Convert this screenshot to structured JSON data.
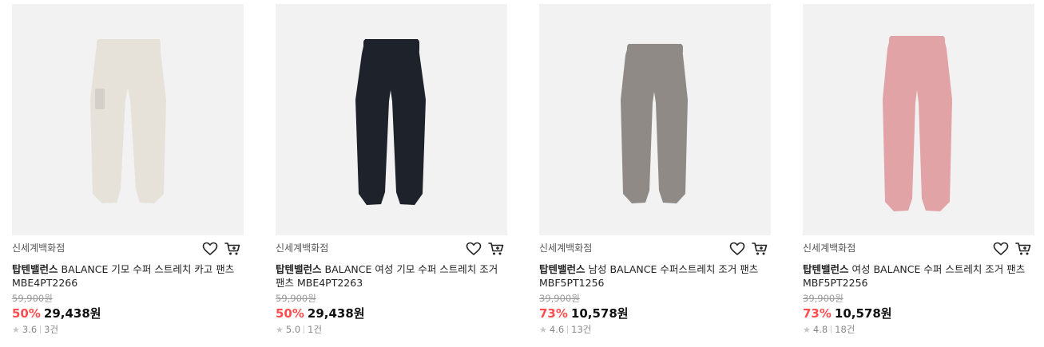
{
  "products": [
    {
      "store": "신세계백화점",
      "brand": "탑텐밸런스",
      "name_line1": " BALANCE 기모 수퍼 스트레치 카고 팬츠",
      "name_line2": "MBE4PT2266",
      "original_price": "59,900원",
      "discount": "50%",
      "price": "29,438원",
      "rating": "3.6",
      "reviews": "3건",
      "pants_color": "#e6e1d9"
    },
    {
      "store": "신세계백화점",
      "brand": "탑텐밸런스",
      "name_line1": " BALANCE 여성 기모 수퍼 스트레치 조거",
      "name_line2": "팬츠 MBE4PT2263",
      "original_price": "59,900원",
      "discount": "50%",
      "price": "29,438원",
      "rating": "5.0",
      "reviews": "1건",
      "pants_color": "#1e222b"
    },
    {
      "store": "신세계백화점",
      "brand": "탑텐밸런스",
      "name_line1": " 남성 BALANCE 수퍼스트레치 조거 팬츠",
      "name_line2": "MBF5PT1256",
      "original_price": "39,900원",
      "discount": "73%",
      "price": "10,578원",
      "rating": "4.6",
      "reviews": "13건",
      "pants_color": "#8f8a86"
    },
    {
      "store": "신세계백화점",
      "brand": "탑텐밸런스",
      "name_line1": " 여성 BALANCE 수퍼 스트레치 조거 팬츠",
      "name_line2": "MBF5PT2256",
      "original_price": "39,900원",
      "discount": "73%",
      "price": "10,578원",
      "rating": "4.8",
      "reviews": "18건",
      "pants_color": "#e2a3a6"
    }
  ]
}
